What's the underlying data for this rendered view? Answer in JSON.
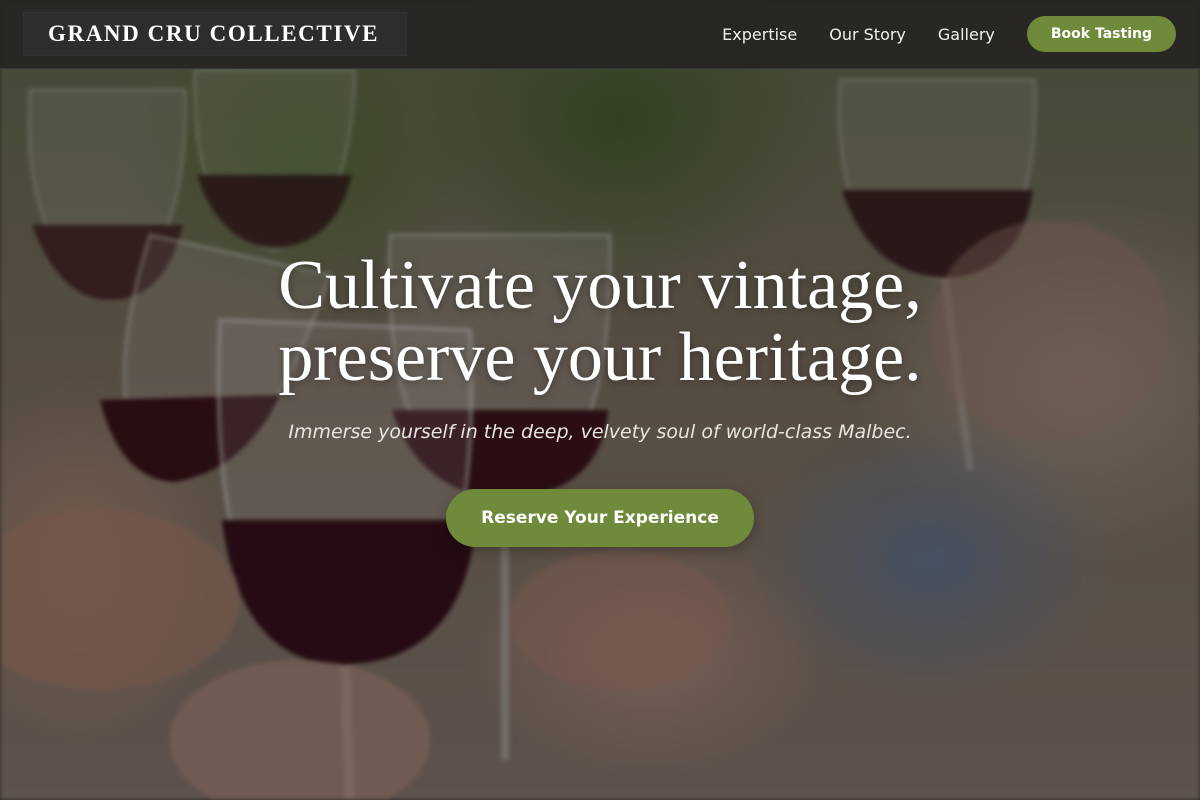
{
  "header": {
    "brand": "GRAND CRU COLLECTIVE",
    "nav": [
      {
        "label": "Expertise"
      },
      {
        "label": "Our Story"
      },
      {
        "label": "Gallery"
      }
    ],
    "cta_label": "Book Tasting"
  },
  "hero": {
    "headline_line1": "Cultivate your vintage,",
    "headline_line2": "preserve your heritage.",
    "subheadline": "Immerse yourself in the deep, velvety soul of world-class Malbec.",
    "cta_label": "Reserve Your Experience",
    "background_image": "wine-glasses-toast-photo"
  },
  "colors": {
    "accent": "#6f8a3a",
    "header_bg": "#262422",
    "text": "#ffffff"
  }
}
